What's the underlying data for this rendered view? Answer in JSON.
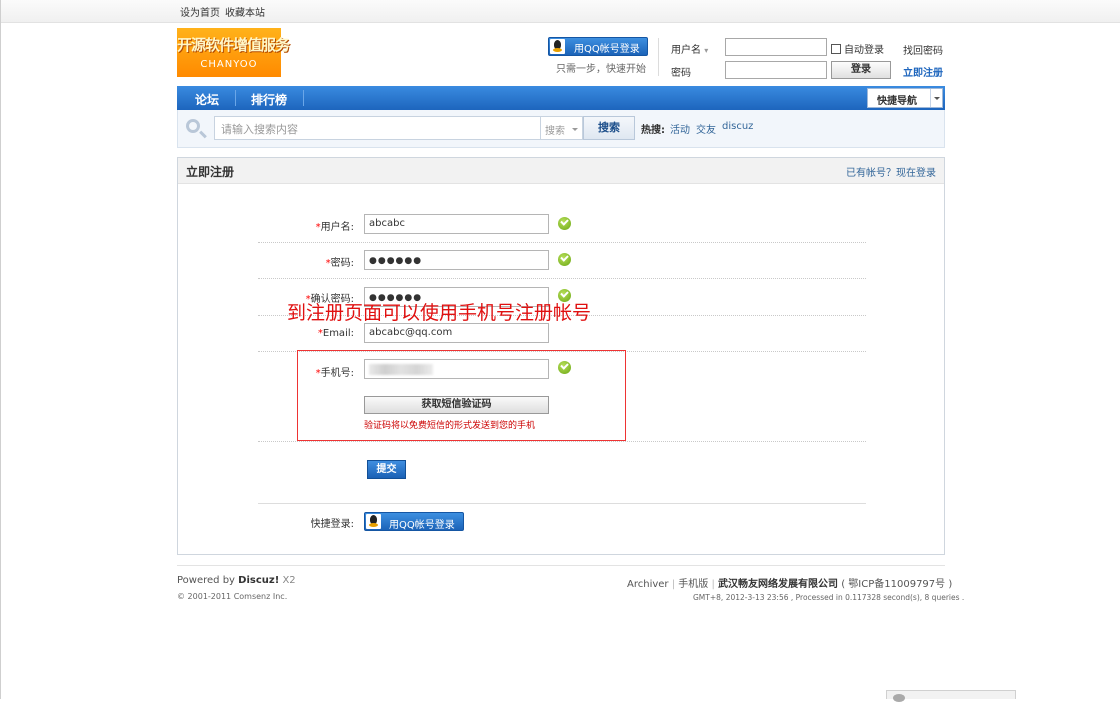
{
  "topbar": {
    "set_home": "设为首页",
    "bookmark": "收藏本站"
  },
  "logo": {
    "line1": "开源软件增值服务",
    "line2": "CHANYOO"
  },
  "header": {
    "qq_login": "用QQ帐号登录",
    "qq_tip": "只需一步，快速开始",
    "username_label": "用户名",
    "password_label": "密码",
    "auto_login": "自动登录",
    "forgot_password": "找回密码",
    "register": "立即注册",
    "login_button": "登录"
  },
  "nav": {
    "items": [
      "论坛",
      "排行榜"
    ],
    "quick_nav": "快捷导航"
  },
  "search": {
    "placeholder": "请输入搜索内容",
    "type": "搜索",
    "button": "搜索",
    "hot_label": "热搜:",
    "hot_items": [
      "活动",
      "交友",
      "discuz"
    ]
  },
  "panel": {
    "title": "立即注册",
    "login_link": "已有帐号？现在登录",
    "fields": {
      "username_label": "用户名:",
      "username_value": "abcabc",
      "password_label": "密码:",
      "password_value": "●●●●●●",
      "confirm_label": "确认密码:",
      "confirm_value": "●●●●●●",
      "email_label": "Email:",
      "email_value": "abcabc@qq.com",
      "phone_label": "手机号:",
      "required_mark": "*"
    },
    "sms_button": "获取短信验证码",
    "sms_tip": "验证码将以免费短信的形式发送到您的手机",
    "submit": "提交",
    "quick_login_label": "快捷登录:",
    "quick_login_button": "用QQ帐号登录"
  },
  "annotation": "到注册页面可以使用手机号注册帐号",
  "footer": {
    "powered_prefix": "Powered by",
    "powered_brand": "Discuz!",
    "powered_version": "X2",
    "copyright": "© 2001-2011 Comsenz Inc.",
    "links": [
      "Archiver",
      "手机版"
    ],
    "company": "武汉畅友网络发展有限公司",
    "icp": "( 鄂ICP备11009797号 )",
    "stats": "GMT+8, 2012-3-13 23:56 , Processed in 0.117328 second(s), 8 queries ."
  },
  "colors": {
    "accent": "#1d65bd",
    "required": "#ff0000",
    "annotation": "#e01010",
    "ok": "#6aa613"
  }
}
